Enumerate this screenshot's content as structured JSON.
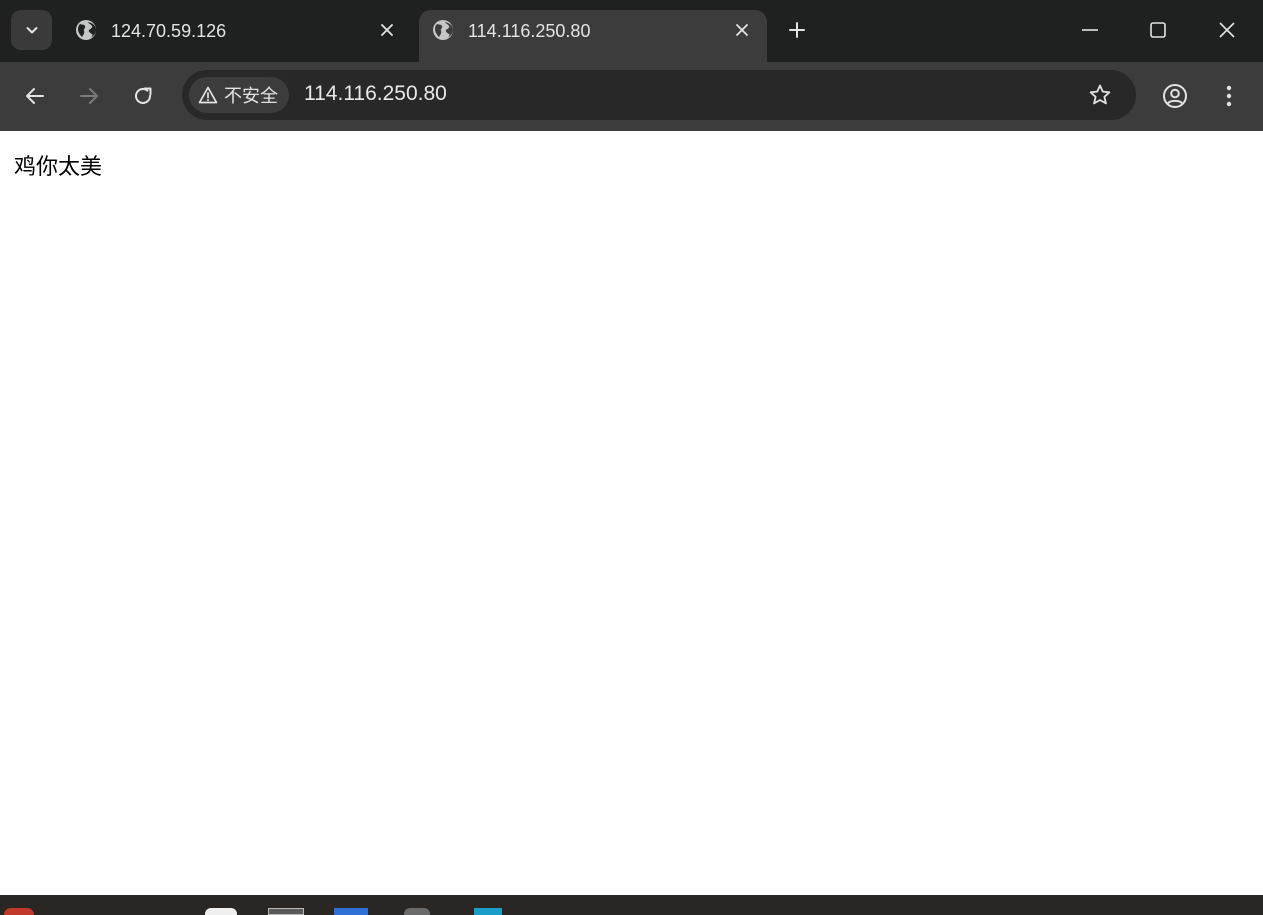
{
  "tabs": [
    {
      "title": "124.70.59.126",
      "active": false
    },
    {
      "title": "114.116.250.80",
      "active": true
    }
  ],
  "toolbar": {
    "security_chip_label": "不安全",
    "url": "114.116.250.80"
  },
  "page": {
    "text": "鸡你太美"
  },
  "colors": {
    "tabstrip_bg": "#1f2020",
    "toolbar_bg": "#3c3c3c",
    "omnibox_bg": "#282828",
    "icon": "#e3e3e3",
    "icon_disabled": "#7a7a7a",
    "page_bg": "#ffffff"
  },
  "icons": {
    "tab_search": "chevron-down-icon",
    "favicon": "globe-icon",
    "tab_close": "close-icon",
    "new_tab": "plus-icon",
    "minimize": "minimize-icon",
    "maximize": "maximize-icon",
    "window_close": "close-icon",
    "back": "arrow-left-icon",
    "forward": "arrow-right-icon",
    "reload": "reload-icon",
    "warning": "warning-icon",
    "bookmark": "star-icon",
    "profile": "profile-icon",
    "menu": "more-vertical-icon"
  }
}
